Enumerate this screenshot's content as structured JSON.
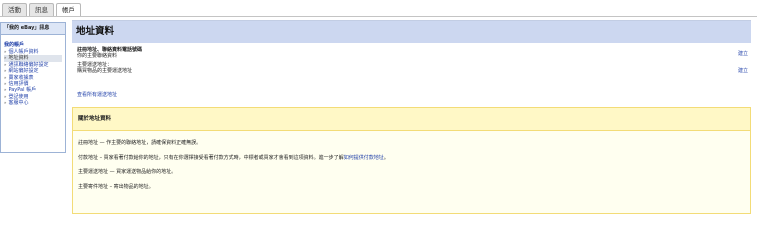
{
  "tabs": [
    {
      "label": "活動"
    },
    {
      "label": "訊息"
    },
    {
      "label": "帳戶"
    }
  ],
  "sidebar": {
    "header": "「我的 eBay」訊息",
    "section_title": "我的帳戶",
    "items": [
      {
        "label": "個人帳戶資料"
      },
      {
        "label": "地址資料"
      },
      {
        "label": "通訊聯絡偏好設定"
      },
      {
        "label": "網站偏好設定"
      },
      {
        "label": "賣家收據表"
      },
      {
        "label": "信用評價"
      },
      {
        "label": "PayPal 帳戶"
      },
      {
        "label": "登記使用"
      },
      {
        "label": "客服中心"
      }
    ]
  },
  "main": {
    "title": "地址資料",
    "registration": {
      "label": "註冊地址、聯絡資料電話號碼",
      "description": "你的主要聯絡資料",
      "create_label": "建立"
    },
    "shipping": {
      "label": "主要運送地址：",
      "description": "購買物品的主要運送地址",
      "create_label": "建立"
    },
    "view_all_link": "查看所有運送地址",
    "about": {
      "title": "關於地址資料",
      "paragraphs": [
        {
          "text": "註冊地址 — 作主要的聯絡地址，請確保資料正確無誤。"
        },
        {
          "text": "付款地址 – 買家看著付款給你的地址，只有在你選擇接受看著付款方式時，中標者或買家才會看到這項資料。進一步了解",
          "link": "如何提供付款地址",
          "suffix": "。"
        },
        {
          "text": "主要運送地址 — 買家運送物品給你的地址。"
        },
        {
          "text": "主要寄件地址 – 寄出物品的地址。"
        }
      ]
    }
  },
  "colors": {
    "link": "#1f3fa8",
    "header_bg": "#ccd7f0",
    "about_bg": "#fffff0",
    "about_border": "#f3dc77"
  }
}
